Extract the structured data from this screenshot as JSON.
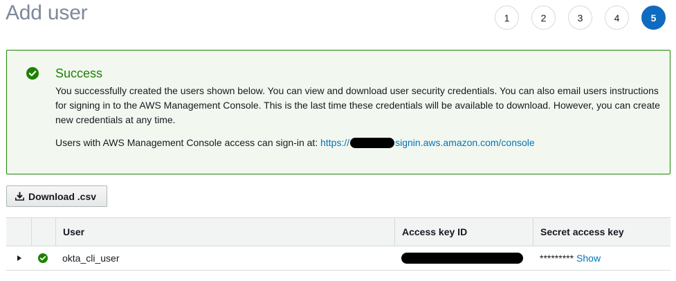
{
  "page": {
    "title": "Add user"
  },
  "steps": [
    {
      "label": "1",
      "active": false
    },
    {
      "label": "2",
      "active": false
    },
    {
      "label": "3",
      "active": false
    },
    {
      "label": "4",
      "active": false
    },
    {
      "label": "5",
      "active": true
    }
  ],
  "alert": {
    "title": "Success",
    "body": "You successfully created the users shown below. You can view and download user security credentials. You can also email users instructions for signing in to the AWS Management Console. This is the last time these credentials will be available to download. However, you can create new credentials at any time.",
    "signin_prefix": "Users with AWS Management Console access can sign-in at:",
    "signin_link_start": "https://",
    "signin_link_end": "signin.aws.amazon.com/console",
    "icon": "check-circle-icon",
    "color": "#1d8102"
  },
  "toolbar": {
    "download_label": "Download .csv",
    "download_icon": "download-icon"
  },
  "table": {
    "columns": [
      "",
      "",
      "User",
      "Access key ID",
      "Secret access key"
    ],
    "rows": [
      {
        "user": "okta_cli_user",
        "secret_masked": "*********",
        "show_label": "Show"
      }
    ]
  },
  "colors": {
    "accent": "#0f6bbf",
    "link": "#0073bb",
    "success": "#1d8102"
  }
}
